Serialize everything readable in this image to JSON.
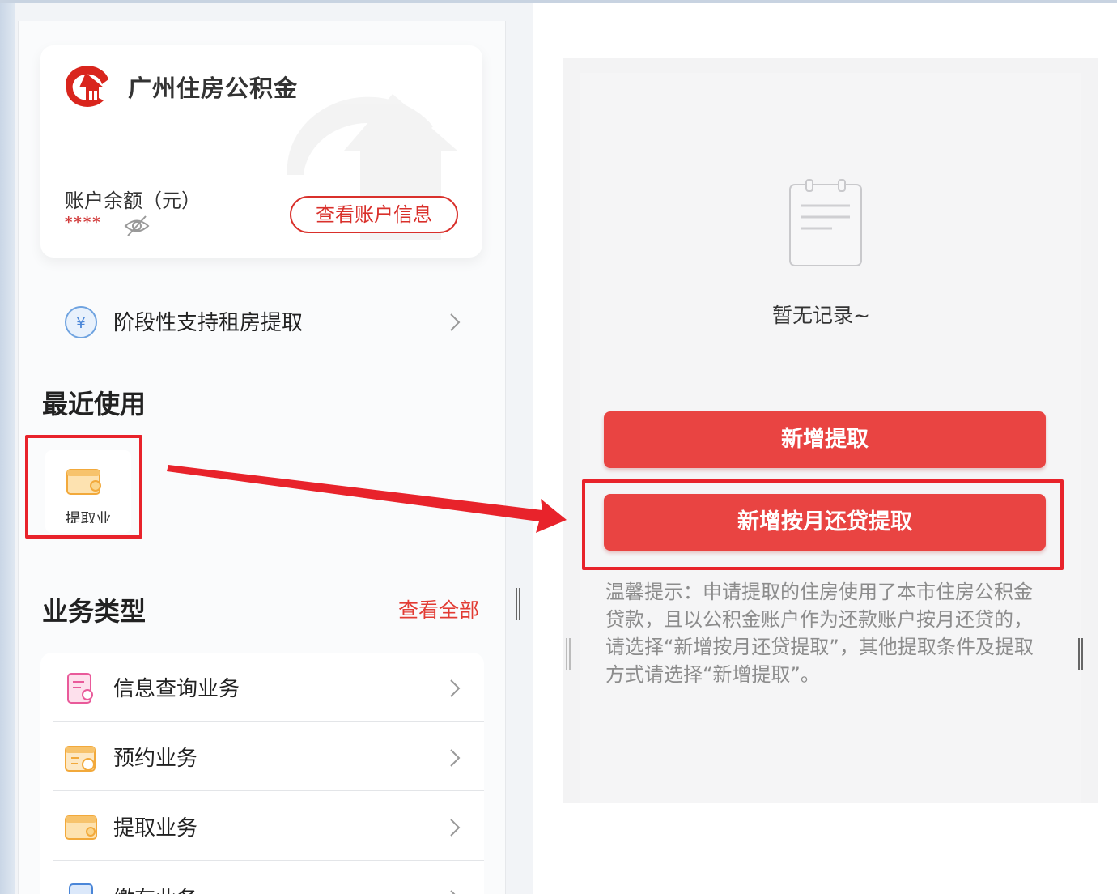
{
  "brand": {
    "name": "广州住房公积金",
    "accent_color": "#e23b33"
  },
  "account": {
    "balance_label": "账户余额（元）",
    "balance_masked": "****",
    "view_account_label": "查看账户信息"
  },
  "rent_support": {
    "label": "阶段性支持租房提取",
    "icon": "yuan-coin-icon"
  },
  "recent": {
    "title": "最近使用",
    "items": [
      {
        "label": "提取业",
        "icon": "wallet-icon"
      }
    ]
  },
  "business": {
    "title": "业务类型",
    "view_all_label": "查看全部",
    "items": [
      {
        "label": "信息查询业务",
        "icon": "document-search-icon"
      },
      {
        "label": "预约业务",
        "icon": "calendar-clock-icon"
      },
      {
        "label": "提取业务",
        "icon": "wallet-icon"
      },
      {
        "label": "缴存业务",
        "icon": "file-icon"
      }
    ]
  },
  "withdrawal": {
    "empty_text": "暂无记录~",
    "add_withdrawal_label": "新增提取",
    "add_monthly_repay_label": "新增按月还贷提取",
    "tip": "温馨提示：申请提取的住房使用了本市住房公积金贷款，且以公积金账户作为还款账户按月还贷的，请选择“新增按月还贷提取”，其他提取条件及提取方式请选择“新增提取”。",
    "button_color": "#e94442",
    "highlight_color": "#e8232b"
  }
}
